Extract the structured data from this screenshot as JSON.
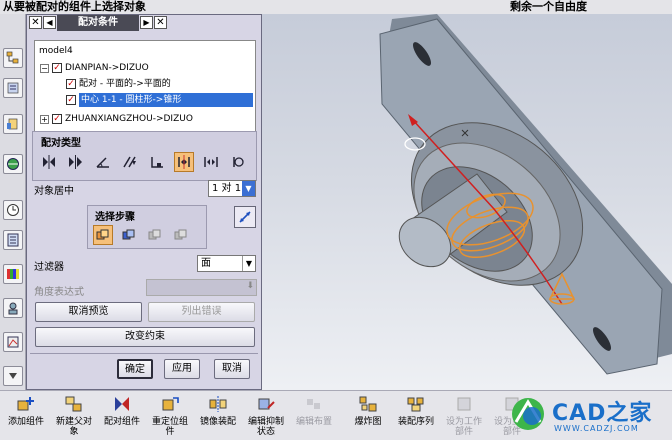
{
  "topbar": {
    "message": "从要被配对的组件上选择对象",
    "status": "剩余一个自由度"
  },
  "dialog": {
    "tab_title": "配对条件",
    "tree": {
      "rows": [
        {
          "label": "model4"
        },
        {
          "label": "DIANPIAN->DIZUO"
        },
        {
          "label": "配对 - 平面的->平面的"
        },
        {
          "label": "中心 1-1 - 圆柱形->锥形"
        },
        {
          "label": "ZHUANXIANGZHOU->DIZUO"
        }
      ]
    },
    "mate_type_label": "配对类型",
    "mate_types": [
      "mate-icon",
      "align-icon",
      "angle-icon",
      "parallel-icon",
      "perpendicular-icon",
      "center-icon",
      "distance-icon",
      "tangent-icon"
    ],
    "object_center_label": "对象居中",
    "object_center_value": "1 对 1",
    "selection_steps_label": "选择步骤",
    "filter_label": "过滤器",
    "filter_value": "面",
    "angle_expr_label": "角度表达式",
    "cancel_preview": "取消预览",
    "list_errors": "列出错误",
    "change_constraint": "改变约束",
    "ok": "确定",
    "apply": "应用",
    "cancel": "取消"
  },
  "toolbar": {
    "items": [
      {
        "label": "添加组件",
        "enabled": true
      },
      {
        "label": "新建父对\n象",
        "enabled": true
      },
      {
        "label": "配对组件",
        "enabled": true
      },
      {
        "label": "重定位组\n件",
        "enabled": true
      },
      {
        "label": "镜像装配",
        "enabled": true
      },
      {
        "label": "编辑抑制\n状态",
        "enabled": true
      },
      {
        "label": "编辑布置",
        "enabled": false
      },
      {
        "label": "爆炸图",
        "enabled": true
      },
      {
        "label": "装配序列",
        "enabled": true
      },
      {
        "label": "设为工作\n部件",
        "enabled": false
      },
      {
        "label": "设为显示\n部件",
        "enabled": false
      }
    ]
  },
  "watermark": {
    "brand": "CAD之家",
    "url": "WWW.CADZJ.COM",
    "colors": {
      "blue": "#1a6fc9",
      "green": "#3db54a"
    }
  }
}
